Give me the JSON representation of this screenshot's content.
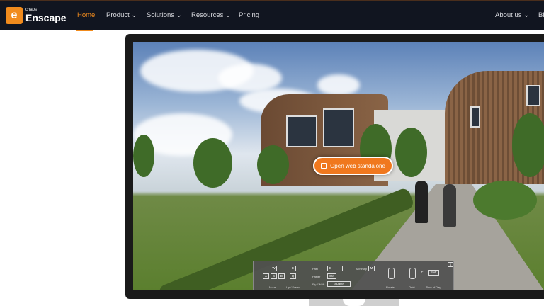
{
  "brand": {
    "small": "chaos",
    "name": "Enscape",
    "logo_letter": "e"
  },
  "nav": {
    "items": [
      {
        "label": "Home",
        "active": true
      },
      {
        "label": "Product ⌄"
      },
      {
        "label": "Solutions ⌄"
      },
      {
        "label": "Resources ⌄"
      },
      {
        "label": "Pricing"
      },
      {
        "label": "About us ⌄"
      },
      {
        "label": "Bl"
      }
    ]
  },
  "accent": "#f18b1d",
  "cta": {
    "label": "Open web standalone",
    "icon": "external-link-icon"
  },
  "controls": {
    "move_keys": [
      "W",
      "A",
      "S",
      "D"
    ],
    "updown_keys": [
      "E",
      "Q"
    ],
    "move_label": "Move",
    "updown_label": "Up / Down",
    "fast_label": "Fast",
    "fast_key": "B",
    "faster_label": "Faster",
    "faster_key": "Ctrl",
    "fly_label": "Fly / Walk",
    "fly_key": "Space",
    "minimap_label": "Minimap",
    "minimap_key": "M",
    "rotate_label": "Rotate",
    "orbit_label": "Orbit",
    "plus": "+",
    "shift_key": "Shift",
    "time_label": "Time of Day",
    "close": "x"
  }
}
